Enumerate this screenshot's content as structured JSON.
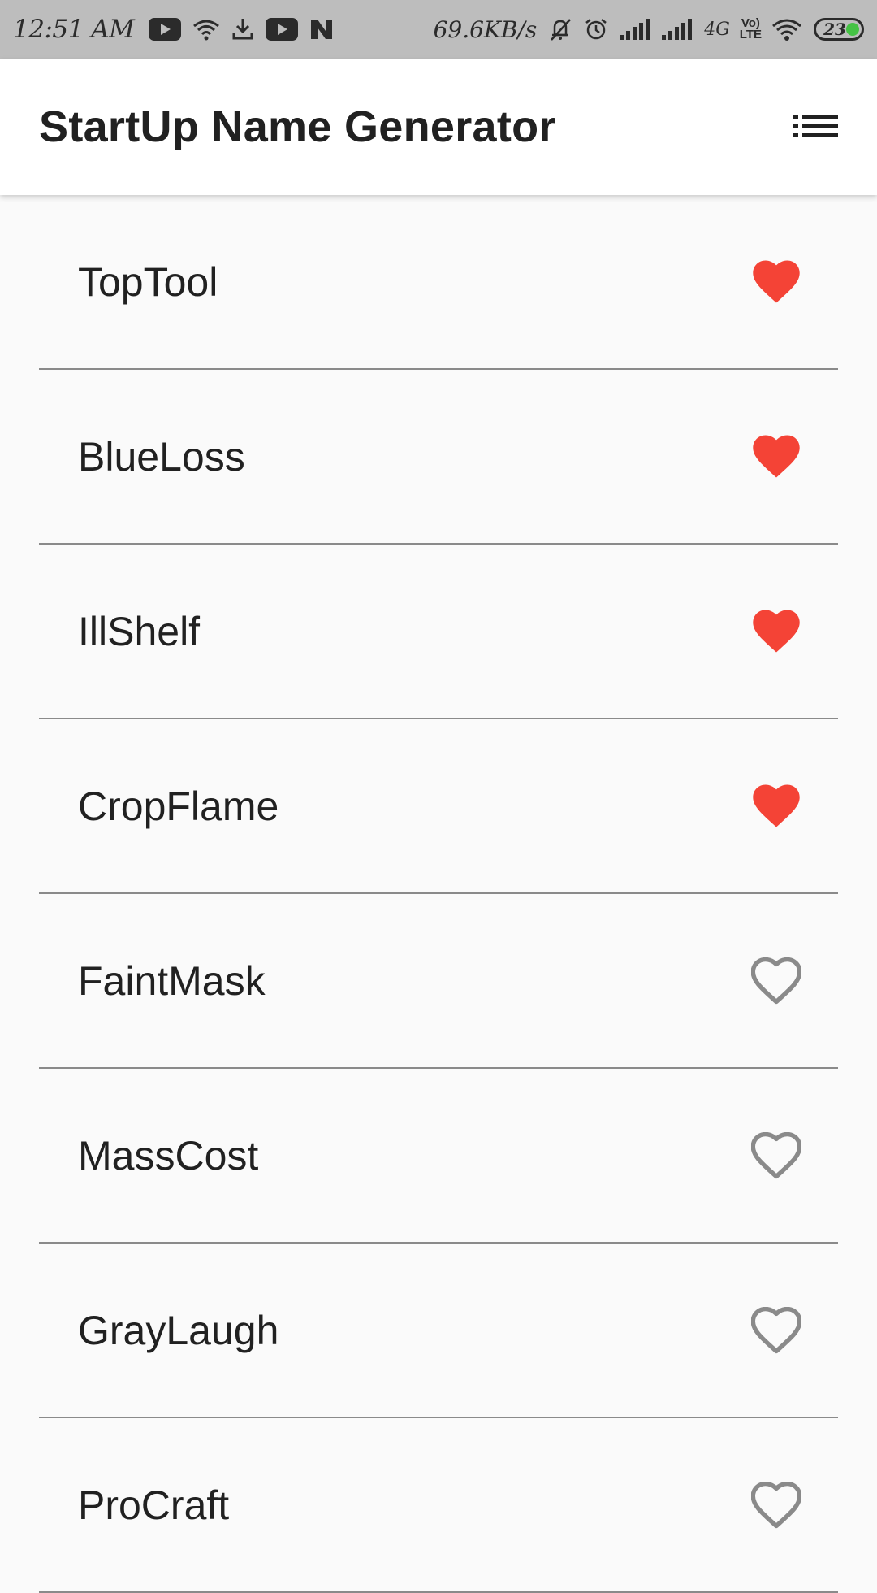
{
  "status_bar": {
    "time": "12:51 AM",
    "speed": "69.6KB/s",
    "network": "4G",
    "volte_top": "Vo)",
    "volte_bottom": "LTE",
    "battery": "23",
    "battery_color": "#44c244",
    "icons": [
      "youtube-icon",
      "wifi-icon",
      "download-icon",
      "youtube-icon",
      "n-icon",
      "muted-bell-icon",
      "alarm-icon",
      "signal-icon",
      "signal-icon",
      "wifi-icon",
      "battery-icon"
    ]
  },
  "app_bar": {
    "title": "StartUp Name Generator",
    "action_icon": "list-icon"
  },
  "colors": {
    "favorite": "#f44336",
    "not_favorite": "#8a8a8a"
  },
  "suggestions": [
    {
      "name": "TopTool",
      "favorite": true
    },
    {
      "name": "BlueLoss",
      "favorite": true
    },
    {
      "name": "IllShelf",
      "favorite": true
    },
    {
      "name": "CropFlame",
      "favorite": true
    },
    {
      "name": "FaintMask",
      "favorite": false
    },
    {
      "name": "MassCost",
      "favorite": false
    },
    {
      "name": "GrayLaugh",
      "favorite": false
    },
    {
      "name": "ProCraft",
      "favorite": false
    }
  ]
}
